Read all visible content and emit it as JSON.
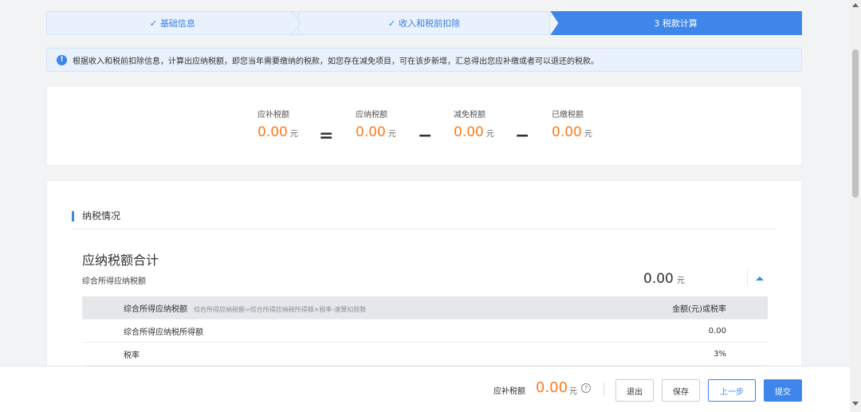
{
  "steps": [
    {
      "label": "基础信息",
      "prefix": "✓"
    },
    {
      "label": "收入和税前扣除",
      "prefix": "✓"
    },
    {
      "label": "3 税款计算",
      "prefix": ""
    }
  ],
  "notice": {
    "icon": "info-icon",
    "text": "根据收入和税前扣除信息，计算出应纳税额，即您当年需要缴纳的税款，如您存在减免项目，可在该步新增，汇总得出您应补缴或者可以退还的税款。"
  },
  "summary": {
    "items": [
      {
        "label": "应补税额",
        "value": "0.00",
        "unit": "元"
      },
      {
        "label": "应纳税额",
        "value": "0.00",
        "unit": "元"
      },
      {
        "label": "减免税额",
        "value": "0.00",
        "unit": "元"
      },
      {
        "label": "已缴税额",
        "value": "0.00",
        "unit": "元"
      }
    ],
    "operators": [
      "=",
      "−",
      "−"
    ]
  },
  "section": {
    "title": "纳税情况",
    "group_title": "应纳税额合计",
    "group_sub": "综合所得应纳税额",
    "group_value": "0.00",
    "group_unit": "元",
    "table": {
      "header": {
        "name": "综合所得应纳税额",
        "formula": "综合所得应纳税额=综合所得应纳税所得额×税率-速算扣除数",
        "value": "金额(元)或税率"
      },
      "rows": [
        {
          "name": "综合所得应纳税所得额",
          "value": "0.00"
        },
        {
          "name": "税率",
          "value": "3%"
        }
      ]
    }
  },
  "footer": {
    "label": "应补税额",
    "value": "0.00",
    "unit": "元",
    "help": "?",
    "buttons": {
      "exit": "退出",
      "save": "保存",
      "prev": "上一步",
      "submit": "提交"
    }
  },
  "colors": {
    "accent": "#3f86ea",
    "amount": "#ff7a1a"
  }
}
